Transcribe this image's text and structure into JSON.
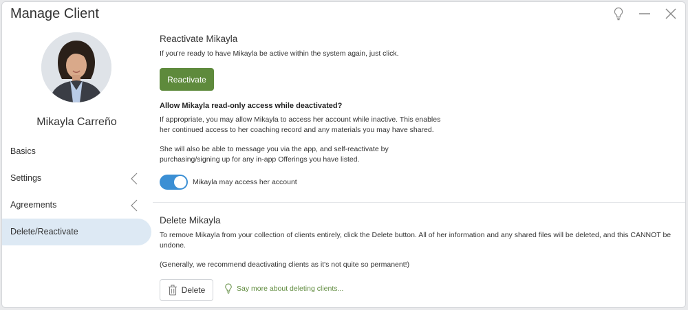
{
  "window": {
    "title": "Manage Client",
    "controls": [
      "lightbulb-icon",
      "minimize-icon",
      "close-icon"
    ]
  },
  "client": {
    "name": "Mikayla Carreño"
  },
  "sidebar": {
    "items": [
      {
        "label": "Basics",
        "chevron": false,
        "active": false
      },
      {
        "label": "Settings",
        "chevron": true,
        "active": false
      },
      {
        "label": "Agreements",
        "chevron": true,
        "active": false
      },
      {
        "label": "Delete/Reactivate",
        "chevron": false,
        "active": true
      }
    ]
  },
  "reactivate": {
    "heading": "Reactivate Mikayla",
    "description": "If you're ready to have Mikayla be active within the system again, just click.",
    "button_label": "Reactivate"
  },
  "readonly": {
    "heading": "Allow Mikayla read-only access while deactivated?",
    "para1_line1": "If appropriate, you may allow Mikayla to access her account while inactive. This enables",
    "para1_line2": "her continued access to her coaching record and any materials you may have shared.",
    "para2_line1": "She will also be able to message you via the app, and self-reactivate by",
    "para2_line2": "purchasing/signing up for any in-app Offerings you have listed.",
    "toggle_label": "Mikayla may access her account",
    "toggle_on": true
  },
  "delete": {
    "heading": "Delete Mikayla",
    "para_line1": "To remove Mikayla from your collection of clients entirely, click the Delete button. All of her information and any shared files will be deleted, and this CANNOT be",
    "para_line2": "undone.",
    "note": "(Generally, we recommend deactivating clients as it's not quite so permanent!)",
    "button_label": "Delete",
    "more_link": "Say more about deleting clients..."
  },
  "colors": {
    "accent_green": "#5e8a3c",
    "toggle_blue": "#3b8fd4",
    "active_nav_bg": "#dde9f4"
  }
}
